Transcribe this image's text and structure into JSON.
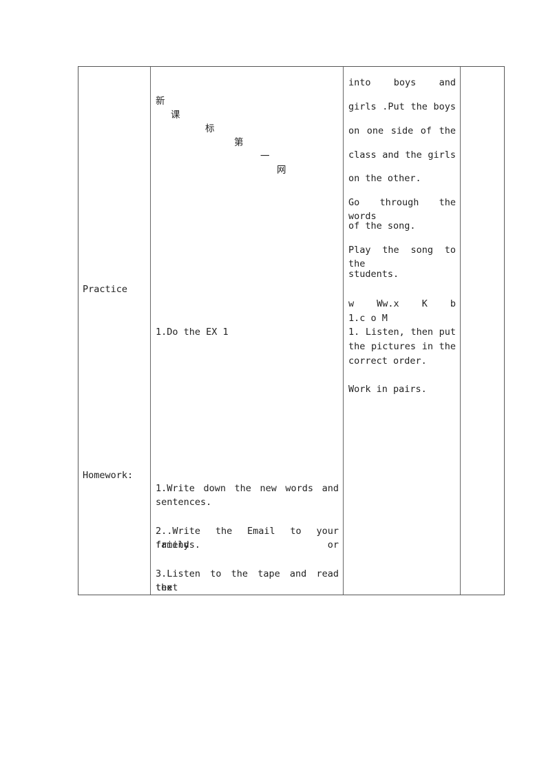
{
  "table": {
    "col1": {
      "practice_label": "Practice",
      "homework_label": "Homework:"
    },
    "col2": {
      "header_chars": [
        "新",
        "课",
        "标",
        "第",
        "一",
        "网"
      ],
      "practice_item": "1.Do the EX 1",
      "homework_items": [
        [
          "1.Write down the new words and",
          "sentences."
        ],
        [
          "2..Write the Email to your family or",
          "friends."
        ],
        [
          "3.Listen to the tape and read the",
          "text"
        ]
      ]
    },
    "col3": {
      "lines_spaced": [
        "into boys and",
        "girls .Put the boys",
        "on one side of the",
        "class and the girls",
        "on the other.",
        "Go through the words",
        "of the song.",
        "Play the song to the",
        "students."
      ],
      "watermark": [
        "w Ww.x K b",
        "1.c o M"
      ],
      "listen_lines": [
        "1. Listen, then put",
        "the pictures in the",
        "correct order."
      ],
      "work_pairs": "Work in pairs."
    },
    "col4": {}
  }
}
